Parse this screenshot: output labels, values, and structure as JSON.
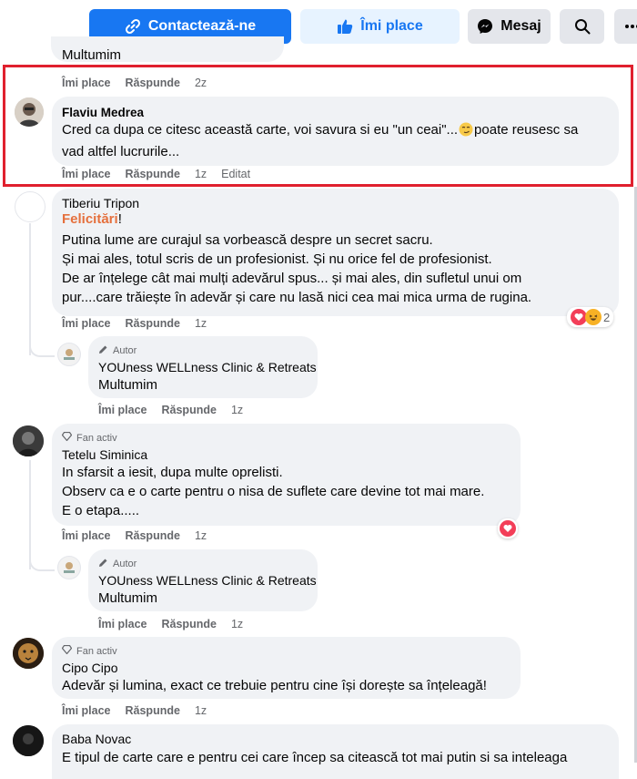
{
  "toolbar": {
    "contact_label": "Contactează-ne",
    "like_label": "Îmi place",
    "message_label": "Mesaj",
    "brand_color": "#1877f2",
    "like_bg": "#e7f3ff"
  },
  "action_labels": {
    "like": "Îmi place",
    "reply": "Răspunde",
    "edited": "Editat"
  },
  "previous_comment": {
    "text": "Multumim",
    "time": "2z"
  },
  "comments": [
    {
      "author": "Flaviu Medrea",
      "lines": [
        "Cred ca dupa ce citesc această carte, voi savura si eu \"un ceai\"...",
        "poate reusesc sa",
        "vad altfel lucrurile..."
      ],
      "time": "1z",
      "edited": true,
      "highlight_color": "#e0202e"
    },
    {
      "author": "Tiberiu Tripon",
      "accent": "Felicitări",
      "accent_suffix": "!",
      "lines": [
        "Putina lume are curajul sa vorbească despre un secret sacru.",
        "Și mai ales, totul scris de un profesionist. Și nu orice fel de profesionist.",
        "De ar înțelege cât mai mulți adevărul spus... și mai ales, din sufletul unui om",
        "pur....care trăiește în adevăr și care nu lasă nici cea mai mica urma de rugina."
      ],
      "time": "1z",
      "reaction_count": "2",
      "reply": {
        "badge": "Autor",
        "author": "YOUness WELLness Clinic & Retreats",
        "text": "Multumim",
        "time": "1z"
      }
    },
    {
      "badge": "Fan activ",
      "author": "Tetelu Siminica",
      "lines": [
        "In sfarsit a iesit, dupa multe oprelisti.",
        "Observ ca e o carte pentru o nisa de suflete care devine tot mai mare.",
        "E o etapa....."
      ],
      "time": "1z",
      "reply": {
        "badge": "Autor",
        "author": "YOUness WELLness Clinic & Retreats",
        "text": "Multumim",
        "time": "1z"
      }
    },
    {
      "badge": "Fan activ",
      "author": "Cipo Cipo",
      "lines": [
        "Adevăr și lumina, exact ce trebuie pentru cine își dorește sa înțeleagă!"
      ],
      "time": "1z"
    },
    {
      "author": "Baba Novac",
      "lines": [
        "E tipul de carte care e pentru cei care încep sa citească tot mai putin si sa inteleaga"
      ]
    }
  ]
}
